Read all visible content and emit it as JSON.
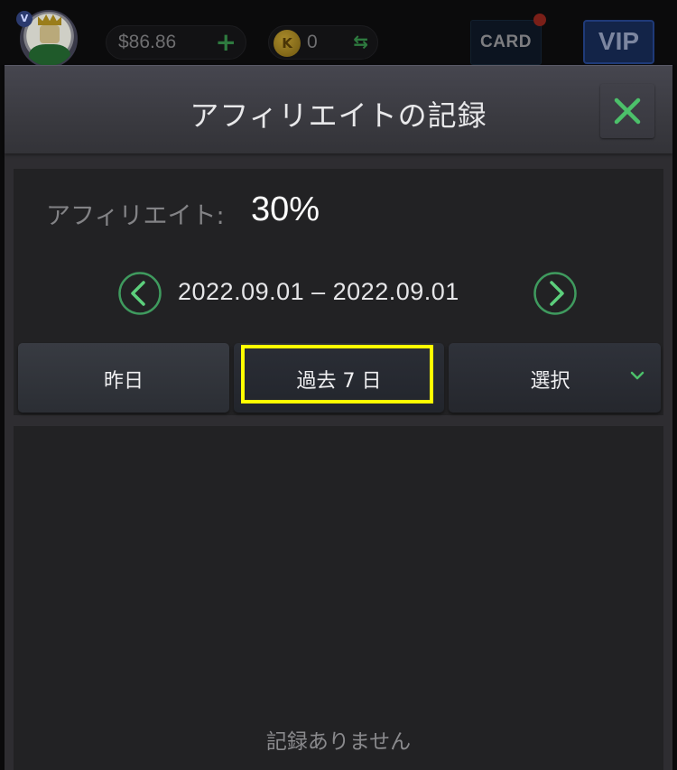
{
  "topbar": {
    "balance": "$86.86",
    "add_icon": "plus-icon",
    "coin_symbol": "K",
    "coin_count": "0",
    "exchange_icon": "swap-arrows-icon",
    "card_label": "CARD",
    "vip_label": "VIP",
    "avatar_badge": "V"
  },
  "modal": {
    "title": "アフィリエイトの記録",
    "close_icon": "close-x-icon",
    "affiliate_label": "アフィリエイト:",
    "affiliate_value": "30%",
    "date_range": "2022.09.01 – 2022.09.01",
    "prev_icon": "chevron-left-circle-icon",
    "next_icon": "chevron-right-circle-icon",
    "filters": [
      {
        "label": "昨日"
      },
      {
        "label": "過去 7 日"
      },
      {
        "label": "選択"
      }
    ],
    "highlighted_filter": "過去 7 日",
    "empty_message": "記録ありません"
  },
  "colors": {
    "accent_green": "#4cc06a",
    "highlight": "#ffff00",
    "notification_dot": "#7a1f18"
  }
}
